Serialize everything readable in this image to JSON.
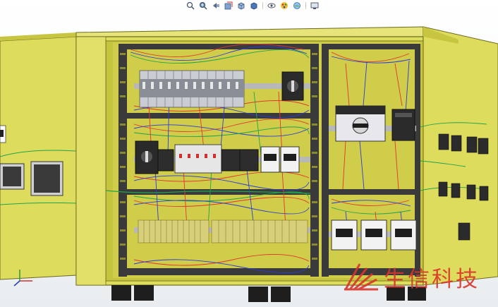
{
  "toolbar": {
    "buttons": [
      {
        "name": "zoom-to-fit-icon"
      },
      {
        "name": "zoom-to-area-icon"
      },
      {
        "name": "previous-view-icon"
      },
      {
        "name": "section-view-icon"
      },
      {
        "name": "view-orientation-icon"
      },
      {
        "name": "display-style-icon"
      },
      {
        "name": "hide-show-items-icon"
      },
      {
        "name": "edit-appearance-icon"
      },
      {
        "name": "apply-scene-icon"
      },
      {
        "name": "view-settings-icon"
      }
    ]
  },
  "model": {
    "cabinet_color": "#dfdd5c",
    "panel_color": "#c8c640",
    "breaker_color": "#c9ccd2",
    "wire_colors": [
      "#e0362e",
      "#2b3bd6",
      "#22a34a",
      "#f0e24b",
      "#222222"
    ]
  },
  "watermark": {
    "text": "生信科技",
    "color": "#d9342b"
  },
  "triad": {
    "x_color": "#d03030",
    "y_color": "#2a9a3a",
    "z_color": "#2040c0"
  }
}
